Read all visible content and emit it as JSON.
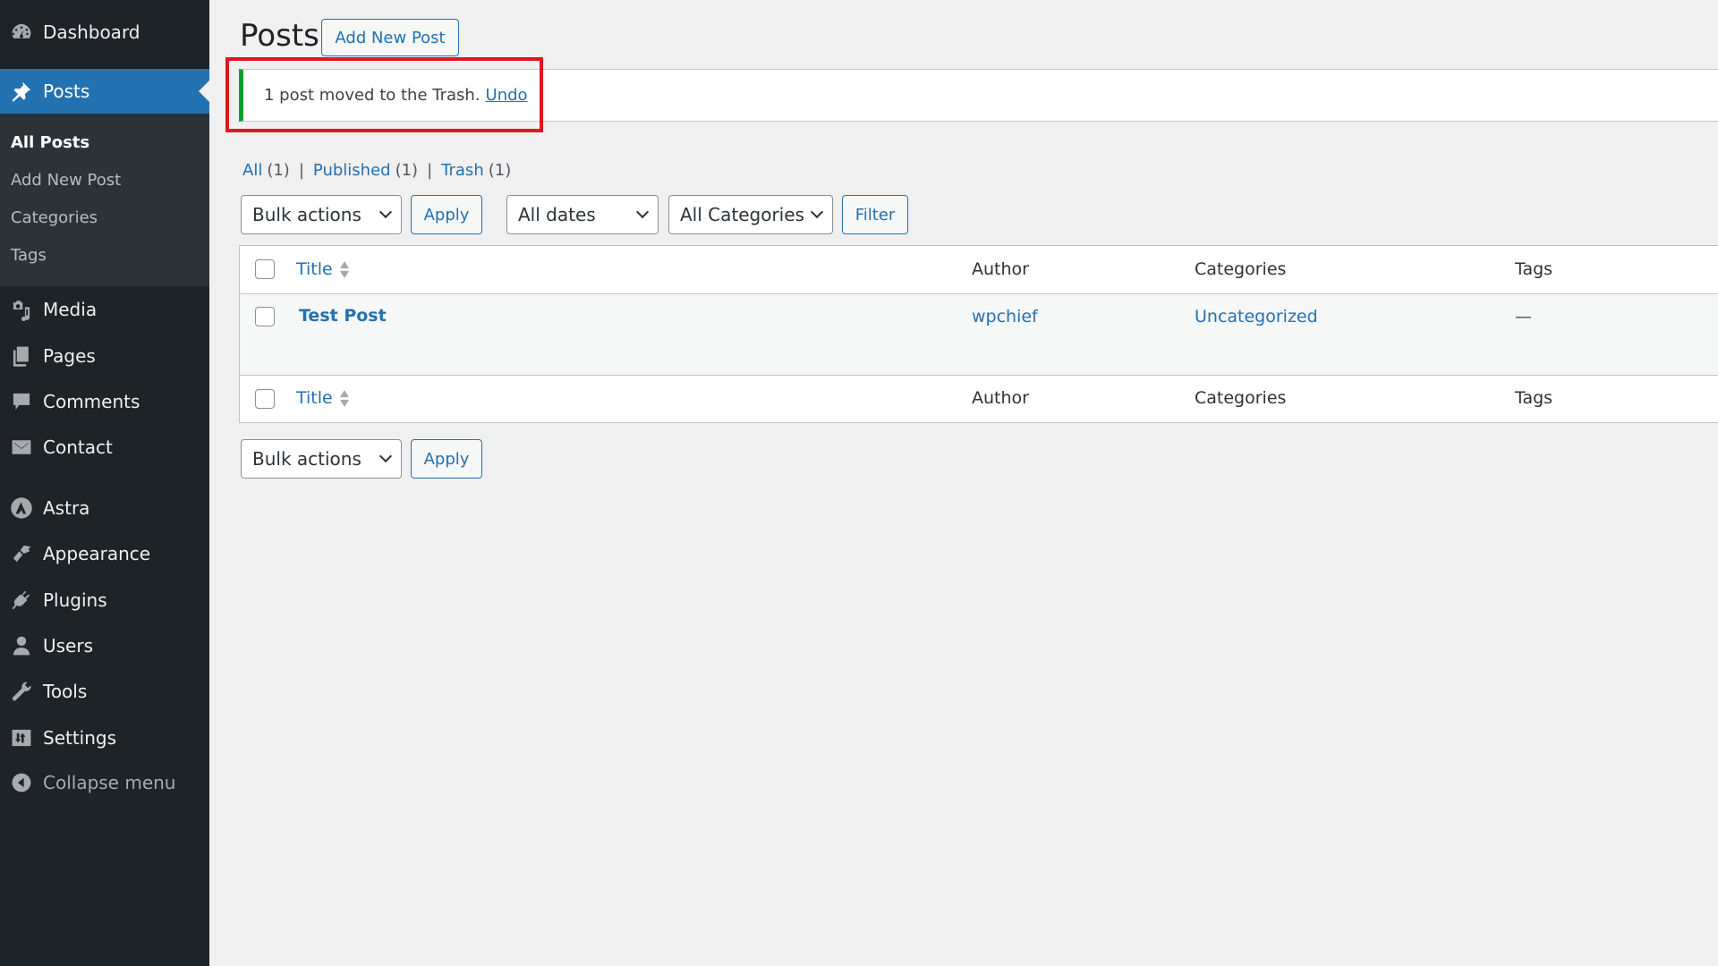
{
  "sidebar": {
    "items": [
      {
        "label": "Dashboard",
        "icon": "dashboard-icon"
      },
      {
        "label": "Posts",
        "icon": "pin-icon",
        "current": true
      },
      {
        "label": "Media",
        "icon": "media-icon"
      },
      {
        "label": "Pages",
        "icon": "pages-icon"
      },
      {
        "label": "Comments",
        "icon": "comment-icon"
      },
      {
        "label": "Contact",
        "icon": "envelope-icon"
      },
      {
        "label": "Astra",
        "icon": "astra-icon"
      },
      {
        "label": "Appearance",
        "icon": "paintbrush-icon"
      },
      {
        "label": "Plugins",
        "icon": "plugin-icon"
      },
      {
        "label": "Users",
        "icon": "user-icon"
      },
      {
        "label": "Tools",
        "icon": "wrench-icon"
      },
      {
        "label": "Settings",
        "icon": "settings-icon"
      }
    ],
    "submenu": [
      {
        "label": "All Posts",
        "current": true
      },
      {
        "label": "Add New Post"
      },
      {
        "label": "Categories"
      },
      {
        "label": "Tags"
      }
    ],
    "collapse_label": "Collapse menu"
  },
  "header": {
    "title": "Posts",
    "add_new_label": "Add New Post"
  },
  "notice": {
    "message": "1 post moved to the Trash.",
    "undo_label": "Undo",
    "accent_color": "#00a32a",
    "highlight_color": "#e0161e"
  },
  "views": [
    {
      "label": "All",
      "count": "(1)"
    },
    {
      "label": "Published",
      "count": "(1)"
    },
    {
      "label": "Trash",
      "count": "(1)"
    }
  ],
  "filters": {
    "bulk_actions": "Bulk actions",
    "apply_label": "Apply",
    "dates": "All dates",
    "categories": "All Categories",
    "filter_label": "Filter"
  },
  "table": {
    "columns": [
      "Title",
      "Author",
      "Categories",
      "Tags"
    ],
    "rows": [
      {
        "title": "Test Post",
        "author": "wpchief",
        "categories": "Uncategorized",
        "tags": "—"
      }
    ]
  },
  "bottom_actions": {
    "bulk_actions": "Bulk actions",
    "apply_label": "Apply"
  }
}
